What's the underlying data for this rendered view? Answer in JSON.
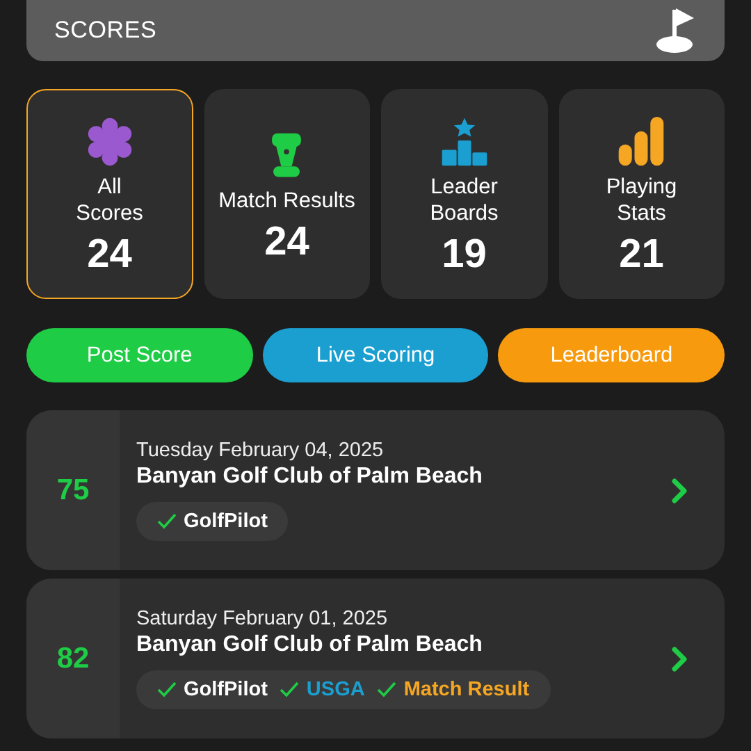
{
  "header": {
    "title": "SCORES"
  },
  "tiles": [
    {
      "kind": "badge",
      "color": "#9b59d0",
      "label": "All\nScores",
      "count": "24",
      "selected": true
    },
    {
      "kind": "trophy",
      "color": "#1fcc45",
      "label": "Match Results",
      "count": "24",
      "selected": false
    },
    {
      "kind": "podium",
      "color": "#1a9fd0",
      "label": "Leader\nBoards",
      "count": "19",
      "selected": false
    },
    {
      "kind": "bars",
      "color": "#f5a623",
      "label": "Playing\nStats",
      "count": "21",
      "selected": false
    }
  ],
  "actions": [
    {
      "label": "Post Score",
      "color": "#1fcc45"
    },
    {
      "label": "Live Scoring",
      "color": "#1a9fd0"
    },
    {
      "label": "Leaderboard",
      "color": "#f79a0e"
    }
  ],
  "rounds": [
    {
      "score": "75",
      "date": "Tuesday February 04, 2025",
      "course": "Banyan Golf Club of Palm Beach",
      "tags": [
        {
          "label": "GolfPilot",
          "color": "#ffffff"
        }
      ]
    },
    {
      "score": "82",
      "date": "Saturday February 01, 2025",
      "course": "Banyan Golf Club of Palm Beach",
      "tags": [
        {
          "label": "GolfPilot",
          "color": "#ffffff"
        },
        {
          "label": "USGA",
          "color": "#1a9fd0"
        },
        {
          "label": "Match Result",
          "color": "#f5a623"
        }
      ]
    }
  ]
}
